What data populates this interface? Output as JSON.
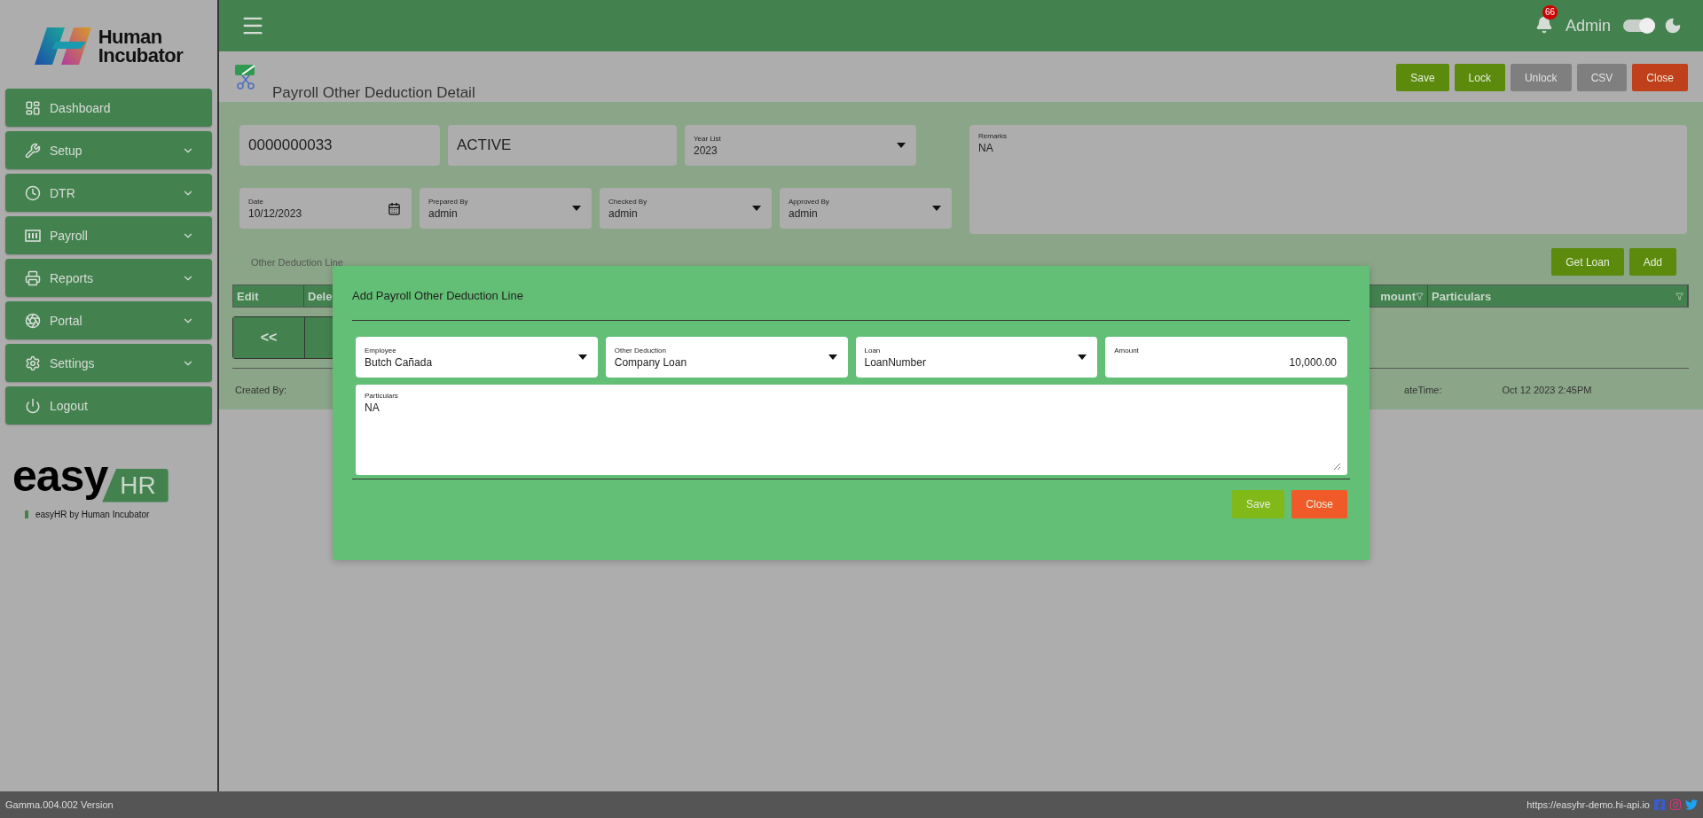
{
  "sidebar": {
    "brand": {
      "line_1": "Human",
      "line_2": "Incubator"
    },
    "items": [
      {
        "label": "Dashboard",
        "expandable": false
      },
      {
        "label": "Setup",
        "expandable": true
      },
      {
        "label": "DTR",
        "expandable": true
      },
      {
        "label": "Payroll",
        "expandable": true
      },
      {
        "label": "Reports",
        "expandable": true
      },
      {
        "label": "Portal",
        "expandable": true
      },
      {
        "label": "Settings",
        "expandable": true
      },
      {
        "label": "Logout",
        "expandable": false
      }
    ],
    "footer_logo": {
      "word": "easy",
      "badge": "HR",
      "caption": "easyHR by Human Incubator"
    }
  },
  "topbar": {
    "notifications": "66",
    "user": "Admin",
    "theme_toggle": {
      "on": true
    }
  },
  "page": {
    "title": "Payroll Other Deduction Detail",
    "actions": [
      {
        "label": "Save",
        "kind": "primary",
        "disabled": false
      },
      {
        "label": "Lock",
        "kind": "primary",
        "disabled": false
      },
      {
        "label": "Unlock",
        "kind": "primary",
        "disabled": true
      },
      {
        "label": "CSV",
        "kind": "primary",
        "disabled": true
      },
      {
        "label": "Close",
        "kind": "danger",
        "disabled": false
      }
    ]
  },
  "form": {
    "row_1": [
      {
        "kind": "text",
        "value": "0000000033"
      },
      {
        "kind": "text",
        "value": "ACTIVE"
      },
      {
        "kind": "select",
        "label": "Year List",
        "value": "2023"
      }
    ],
    "row_2": [
      {
        "kind": "date",
        "label": "Date",
        "value": "10/12/2023"
      },
      {
        "kind": "select",
        "label": "Prepared By",
        "value": "admin"
      },
      {
        "kind": "select",
        "label": "Checked By",
        "value": "admin"
      },
      {
        "kind": "select",
        "label": "Approved By",
        "value": "admin"
      }
    ],
    "remarks": {
      "label": "Remarks",
      "value": "NA"
    }
  },
  "lines": {
    "title": "Other Deduction Line",
    "actions": [
      {
        "label": "Get Loan"
      },
      {
        "label": "Add"
      }
    ],
    "columns": [
      "Edit",
      "Dele",
      "mount",
      "Particulars"
    ],
    "pager": [
      "<<"
    ],
    "footer": [
      {
        "label": "Created By:"
      },
      {
        "label": "ateTime:",
        "value": "Oct 12 2023 2:45PM"
      }
    ]
  },
  "modal": {
    "title": "Add Payroll Other Deduction Line",
    "fields": [
      {
        "kind": "select",
        "label": "Employee",
        "value": "Butch  Cañada"
      },
      {
        "kind": "select",
        "label": "Other Deduction",
        "value": "Company Loan"
      },
      {
        "kind": "select",
        "label": "Loan",
        "value": "LoanNumber"
      },
      {
        "kind": "number",
        "label": "Amount",
        "value": "10,000.00"
      }
    ],
    "particulars": {
      "label": "Particulars",
      "value": "NA"
    },
    "actions": [
      {
        "label": "Save",
        "kind": "primary"
      },
      {
        "label": "Close",
        "kind": "danger"
      }
    ]
  },
  "status_bar": {
    "version": "Gamma.004.002 Version",
    "url": "https://easyhr-demo.hi-api.io"
  }
}
